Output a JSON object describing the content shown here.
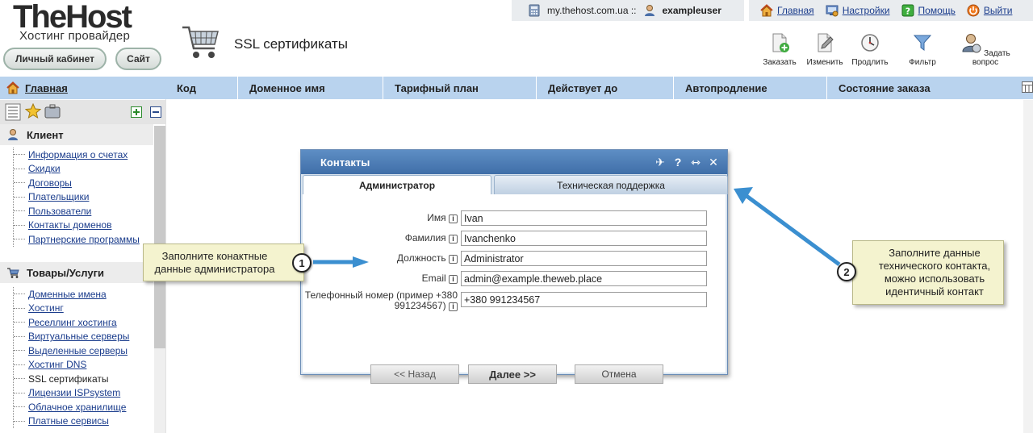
{
  "brand": {
    "title": "TheHost",
    "subtitle": "Хостинг провайдер"
  },
  "header_buttons": {
    "cabinet": "Личный кабинет",
    "site": "Сайт"
  },
  "page_title": "SSL сертификаты",
  "userbar": {
    "domain": "my.thehost.com.ua ::",
    "user": "exampleuser"
  },
  "topnav": [
    {
      "label": "Главная",
      "icon": "home-icon"
    },
    {
      "label": "Настройки",
      "icon": "settings-icon"
    },
    {
      "label": "Помощь",
      "icon": "help-icon"
    },
    {
      "label": "Выйти",
      "icon": "power-icon"
    }
  ],
  "toolbar": [
    {
      "label": "Заказать",
      "icon": "order-icon"
    },
    {
      "label": "Изменить",
      "icon": "edit-icon"
    },
    {
      "label": "Продлить",
      "icon": "renew-icon"
    },
    {
      "label": "Фильтр",
      "icon": "filter-icon"
    },
    {
      "label": "Задать вопрос",
      "icon": "ask-question-icon"
    }
  ],
  "nav": {
    "home": "Главная",
    "sections": [
      {
        "title": "Клиент",
        "items": [
          "Информация о счетах",
          "Скидки",
          "Договоры",
          "Плательщики",
          "Пользователи",
          "Контакты доменов",
          "Партнерские программы"
        ]
      },
      {
        "title": "Товары/Услуги",
        "items": [
          "Доменные имена",
          "Хостинг",
          "Реселлинг хостинга",
          "Виртуальные серверы",
          "Выделенные серверы",
          "Хостинг DNS",
          "SSL сертификаты",
          "Лицензии ISPsystem",
          "Облачное хранилище",
          "Платные сервисы"
        ]
      }
    ]
  },
  "grid": {
    "columns": [
      "Код",
      "Доменное имя",
      "Тарифный план",
      "Действует до",
      "Автопродление",
      "Состояние заказа"
    ]
  },
  "dialog": {
    "title": "Контакты",
    "tabs": {
      "admin": "Администратор",
      "tech": "Техническая поддержка"
    },
    "fields": [
      {
        "label": "Имя",
        "value": "Ivan"
      },
      {
        "label": "Фамилия",
        "value": "Ivanchenko"
      },
      {
        "label": "Должность",
        "value": "Administrator"
      },
      {
        "label": "Email",
        "value": "admin@example.theweb.place"
      },
      {
        "label": "Телефонный номер (пример +380 991234567)",
        "value": "+380 991234567"
      }
    ],
    "buttons": {
      "back": "<< Назад",
      "next": "Далее >>",
      "cancel": "Отмена"
    }
  },
  "callouts": {
    "one": {
      "number": "1",
      "text": "Заполните конактные данные администратора"
    },
    "two": {
      "number": "2",
      "text": "Заполните данные технического контакта, можно использовать идентичный контакт"
    }
  },
  "colors": {
    "header_blue": "#b9d3ee",
    "dialog_title": "#4a7ab5",
    "callout_bg": "#f4f3cf",
    "link": "#1a3c8c"
  }
}
